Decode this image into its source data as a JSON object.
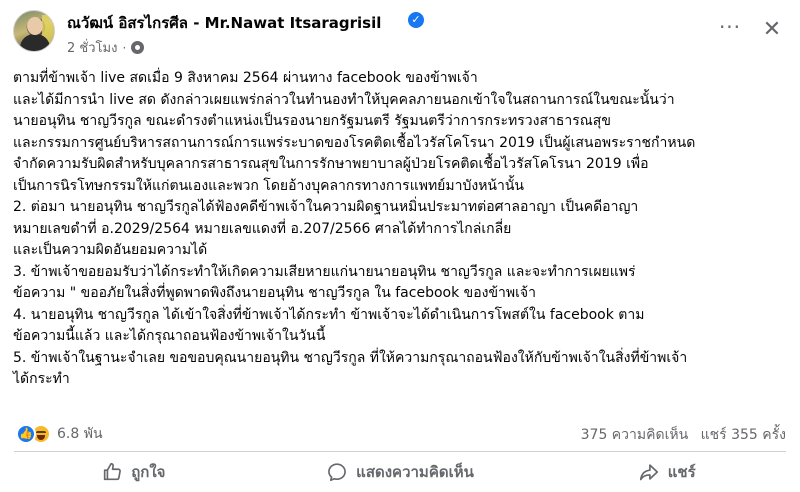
{
  "post": {
    "author": "ณวัฒน์ อิสรไกรศีล - Mr.Nawat Itsaragrisil",
    "time": "2 ชั่วโมง",
    "separator": "·",
    "lines": [
      "ตามที่ข้าพเจ้า live สดเมื่อ 9 สิงหาคม 2564 ผ่านทาง facebook  ของข้าพเจ้า",
      "และได้มีการนำ live สด ดังกล่าวเผยแพร่กล่าวในทำนองทำให้บุคคลภายนอกเข้าใจในสถานการณ์ในขณะนั้นว่า",
      "นายอนุทิน ชาญวีรกูล ขณะดำรงตำแหน่งเป็นรองนายกรัฐมนตรี รัฐมนตรีว่าการกระทรวงสาธารณสุข",
      "และกรรมการศูนย์บริหารสถานการณ์การแพร่ระบาดของโรคติดเชื้อไวรัสโคโรนา 2019 เป็นผู้เสนอพระราชกำหนด",
      "จำกัดความรับผิดสำหรับบุคลากรสาธารณสุขในการรักษาพยาบาลผู้ป่วยโรคติดเชื้อไวรัสโคโรนา 2019 เพื่อ",
      "เป็นการนิรโทษกรรมให้แก่ตนเองและพวก โดยอ้างบุคลากรทางการแพทย์มาบังหน้านั้น",
      " 2. ต่อมา นายอนุทิน ชาญวีรกูลได้ฟ้องคดีข้าพเจ้าในความผิดฐานหมิ่นประมาทต่อศาลอาญา เป็นคดีอาญา",
      "หมายเลขดำที่ อ.2029/2564 หมายเลขแดงที่ อ.207/2566  ศาลได้ทำการไกล่เกลี่ย",
      "และเป็นความผิดอันยอมความได้",
      "3. ข้าพเจ้าขอยอมรับว่าได้กระทำให้เกิดความเสียหายแก่นายนายอนุทิน  ชาญวีรกูล และจะทำการเผยแพร่",
      "ข้อความ \" ขออภัยในสิ่งที่พูดพาดพิงถึงนายอนุทิน  ชาญวีรกูล ใน facebook ของข้าพเจ้า",
      "4. นายอนุทิน  ชาญวีรกูล ได้เข้าใจสิ่งที่ข้าพเจ้าได้กระทำ ข้าพเจ้าจะได้ดำเนินการโพสต์ใน facebook ตาม",
      "ข้อความนี้แล้ว และได้กรุณาถอนฟ้องข้าพเจ้าในวันนี้",
      "5. ข้าพเจ้าในฐานะจำเลย ขอขอบคุณนายอนุทิน ชาญวีรกูล ที่ให้ความกรุณาถอนฟ้องให้กับข้าพเจ้าในสิ่งที่ข้าพเจ้า",
      "ได้กระทำ"
    ]
  },
  "stats": {
    "reaction_count": "6.8 พัน",
    "comments": "375 ความคิดเห็น",
    "shares": "แชร์ 355 ครั้ง"
  },
  "actions": {
    "like": "ถูกใจ",
    "comment": "แสดงความคิดเห็น",
    "share": "แชร์"
  },
  "icons": {
    "verified": "verified-badge-icon",
    "privacy": "globe-icon",
    "more": "more-options-icon",
    "close": "close-icon",
    "like": "thumbs-up-icon",
    "comment": "comment-bubble-icon",
    "share": "share-arrow-icon"
  },
  "colors": {
    "accent": "#1877f2",
    "secondary_text": "#65676b",
    "haha": "#f7b928"
  }
}
